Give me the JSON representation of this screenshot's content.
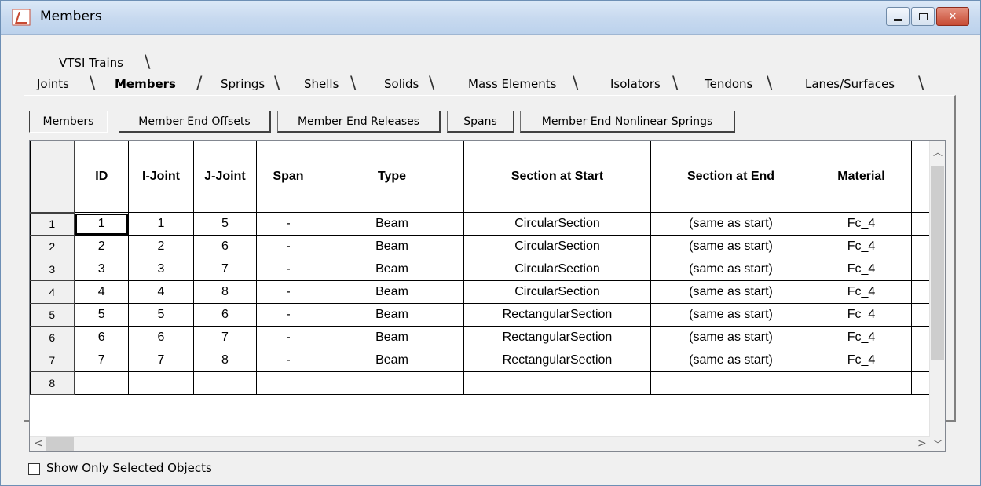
{
  "window": {
    "title": "Members",
    "controls": {
      "minimize": "minimize",
      "maximize": "maximize",
      "close": "close"
    }
  },
  "tabs_back_row": [
    {
      "label": "VTSI Trains"
    }
  ],
  "tabs_front_row": [
    {
      "label": "Joints"
    },
    {
      "label": "Members",
      "active": true
    },
    {
      "label": "Springs"
    },
    {
      "label": "Shells"
    },
    {
      "label": "Solids"
    },
    {
      "label": "Mass Elements"
    },
    {
      "label": "Isolators"
    },
    {
      "label": "Tendons"
    },
    {
      "label": "Lanes/Surfaces"
    }
  ],
  "subtabs": [
    {
      "label": "Members",
      "pressed": true
    },
    {
      "label": "Member End Offsets"
    },
    {
      "label": "Member End Releases"
    },
    {
      "label": "Spans"
    },
    {
      "label": "Member End Nonlinear Springs"
    }
  ],
  "grid": {
    "columns": [
      "ID",
      "I-Joint",
      "J-Joint",
      "Span",
      "Type",
      "Section at Start",
      "Section at End",
      "Material"
    ],
    "rows": [
      {
        "num": "1",
        "cells": [
          "1",
          "1",
          "5",
          "-",
          "Beam",
          "CircularSection",
          "(same as start)",
          "Fc_4"
        ]
      },
      {
        "num": "2",
        "cells": [
          "2",
          "2",
          "6",
          "-",
          "Beam",
          "CircularSection",
          "(same as start)",
          "Fc_4"
        ]
      },
      {
        "num": "3",
        "cells": [
          "3",
          "3",
          "7",
          "-",
          "Beam",
          "CircularSection",
          "(same as start)",
          "Fc_4"
        ]
      },
      {
        "num": "4",
        "cells": [
          "4",
          "4",
          "8",
          "-",
          "Beam",
          "CircularSection",
          "(same as start)",
          "Fc_4"
        ]
      },
      {
        "num": "5",
        "cells": [
          "5",
          "5",
          "6",
          "-",
          "Beam",
          "RectangularSection",
          "(same as start)",
          "Fc_4"
        ]
      },
      {
        "num": "6",
        "cells": [
          "6",
          "6",
          "7",
          "-",
          "Beam",
          "RectangularSection",
          "(same as start)",
          "Fc_4"
        ]
      },
      {
        "num": "7",
        "cells": [
          "7",
          "7",
          "8",
          "-",
          "Beam",
          "RectangularSection",
          "(same as start)",
          "Fc_4"
        ]
      },
      {
        "num": "8",
        "cells": [
          "",
          "",
          "",
          "",
          "",
          "",
          "",
          ""
        ]
      }
    ]
  },
  "footer": {
    "checkbox_label": "Show Only Selected Objects",
    "checked": false
  },
  "colors": {
    "titlebar": "#c7d9ef",
    "close_button": "#c74a33",
    "background": "#f0f0f0"
  }
}
